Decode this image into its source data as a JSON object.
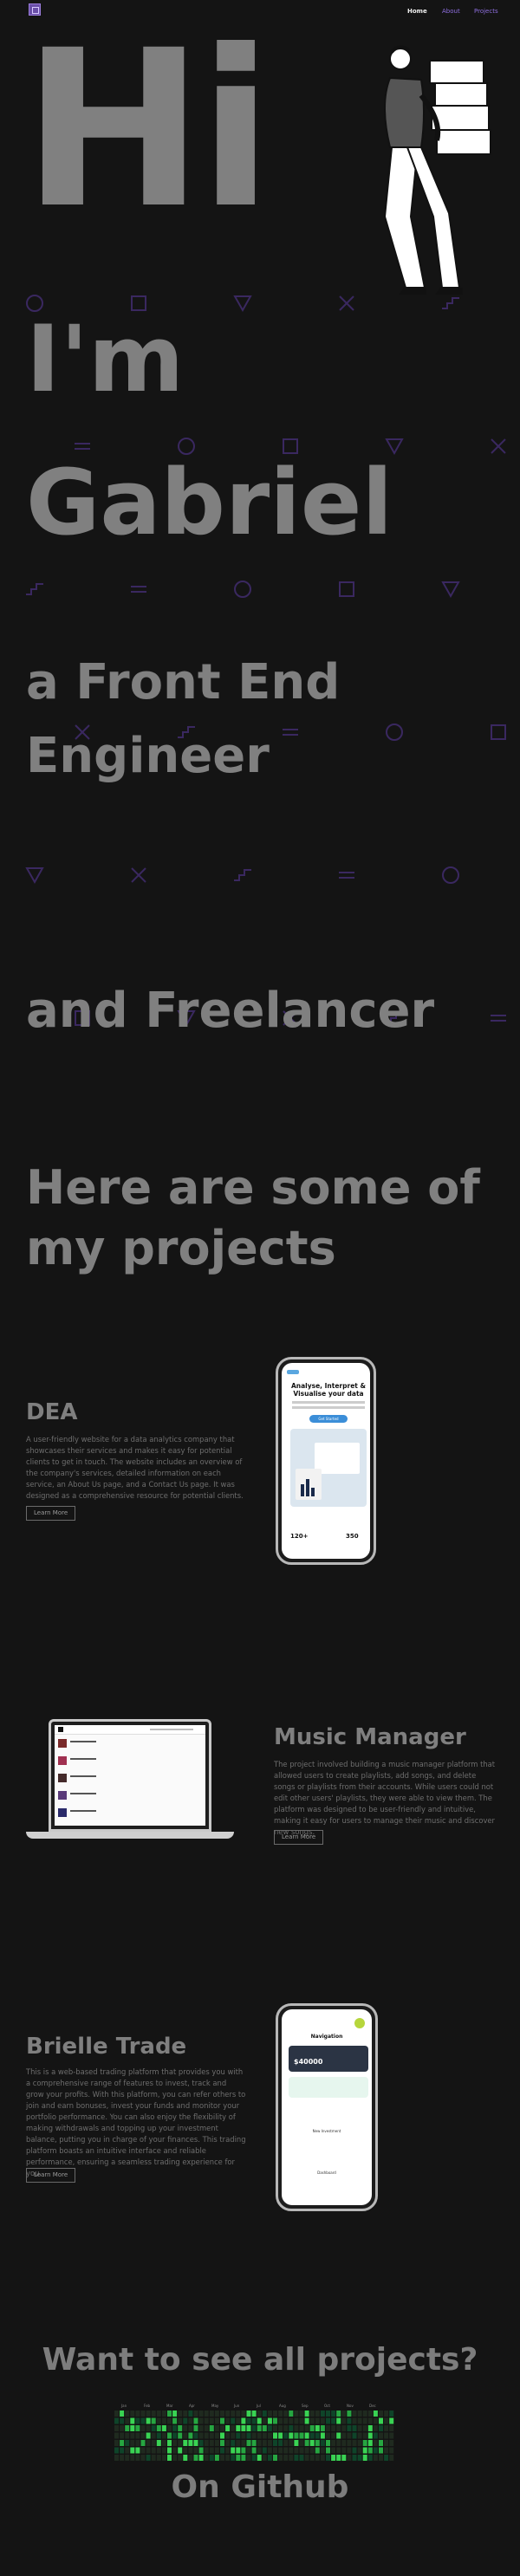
{
  "nav": {
    "logo": "logo",
    "links": [
      {
        "label": "Home",
        "active": true
      },
      {
        "label": "About",
        "active": false
      },
      {
        "label": "Projects",
        "active": false
      }
    ]
  },
  "hero": {
    "hi": "Hi",
    "im": "I'm",
    "name": "Gabriel",
    "role_line1": "a Front End",
    "role_line2": "Engineer",
    "freelancer": "and Freelancer",
    "projects_line1": "Here are some of",
    "projects_line2": "my projects"
  },
  "projects": [
    {
      "title": "DEA",
      "description": "A user-friendly website for a data analytics company that showcases their services and makes it easy for potential clients to get in touch. The website includes an overview of the company's services, detailed information on each service, an About Us page, and a Contact Us page. It was designed as a comprehensive resource for potential clients.",
      "button": "Learn More",
      "mockup": {
        "heading": "Analyse, Interpret & Visualise your data",
        "cta": "Get Started",
        "stat1": "120+",
        "stat2": "350"
      }
    },
    {
      "title": "Music Manager",
      "description": "The project involved building a music manager platform that allowed users to create playlists, add songs, and delete songs or playlists from their accounts. While users could not edit other users' playlists, they were able to view them. The platform was designed to be user-friendly and intuitive, making it easy for users to manage their music and discover new songs.",
      "button": "Learn More"
    },
    {
      "title": "Brielle Trade",
      "description": "This is a web-based trading platform that provides you with a comprehensive range of features to invest, track and grow your profits. With this platform, you can refer others to join and earn bonuses, invest your funds and monitor your portfolio performance. You can also enjoy the flexibility of making withdrawals and topping up your investment balance, putting you in charge of your finances. This trading platform boasts an intuitive interface and reliable performance, ensuring a seamless trading experience for you.",
      "button": "Learn More",
      "mockup": {
        "heading": "Navigation",
        "balance": "$40000",
        "item": "New Investment",
        "item2": "Dashboard"
      }
    }
  ],
  "github": {
    "title": "Want to see all projects?",
    "subtitle": "On Github",
    "months": [
      "Jan",
      "Feb",
      "Mar",
      "Apr",
      "May",
      "Jun",
      "Jul",
      "Aug",
      "Sep",
      "Oct",
      "Nov",
      "Dec"
    ]
  },
  "colors": {
    "background": "#141414",
    "accent": "#8f6fe0",
    "text": "#808080",
    "pattern": "#3d2a66"
  }
}
